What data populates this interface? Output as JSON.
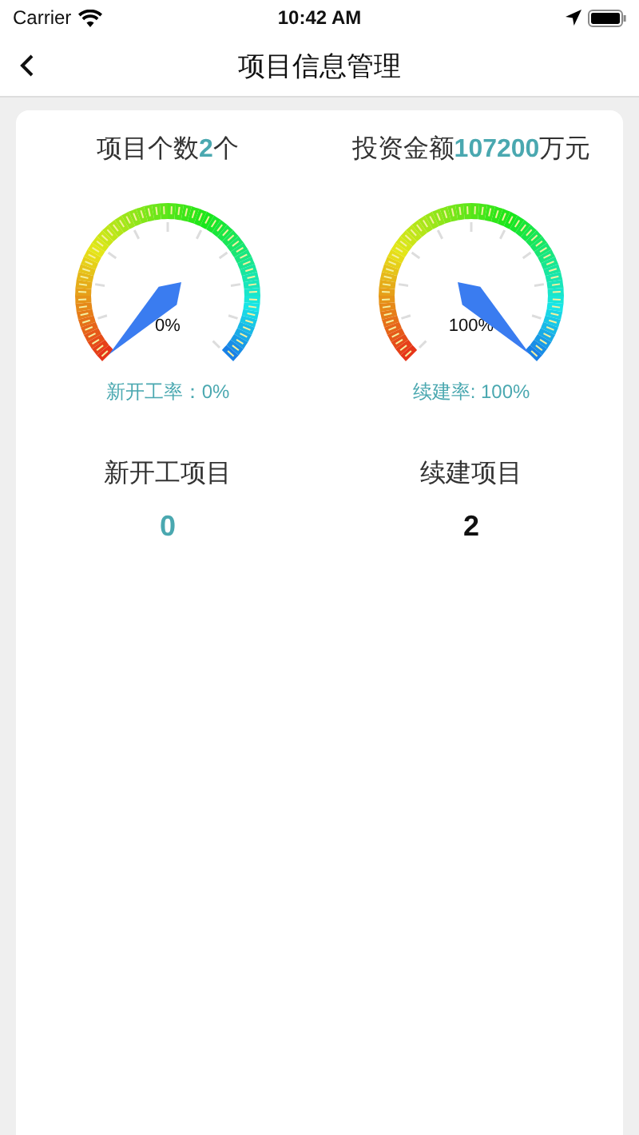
{
  "status_bar": {
    "carrier": "Carrier",
    "time": "10:42 AM"
  },
  "nav_bar": {
    "title": "项目信息管理"
  },
  "summary": [
    {
      "label": "项目个数",
      "value": "2",
      "unit": "个"
    },
    {
      "label": "投资金额",
      "value": "107200",
      "unit": "万元"
    }
  ],
  "gauges": [
    {
      "reading": "0%",
      "caption": "新开工率：0%"
    },
    {
      "reading": "100%",
      "caption": "续建率: 100%"
    }
  ],
  "counts": [
    {
      "label": "新开工项目",
      "value": "0",
      "color": "#4aa8b0"
    },
    {
      "label": "续建项目",
      "value": "2",
      "color": "#111111"
    }
  ]
}
